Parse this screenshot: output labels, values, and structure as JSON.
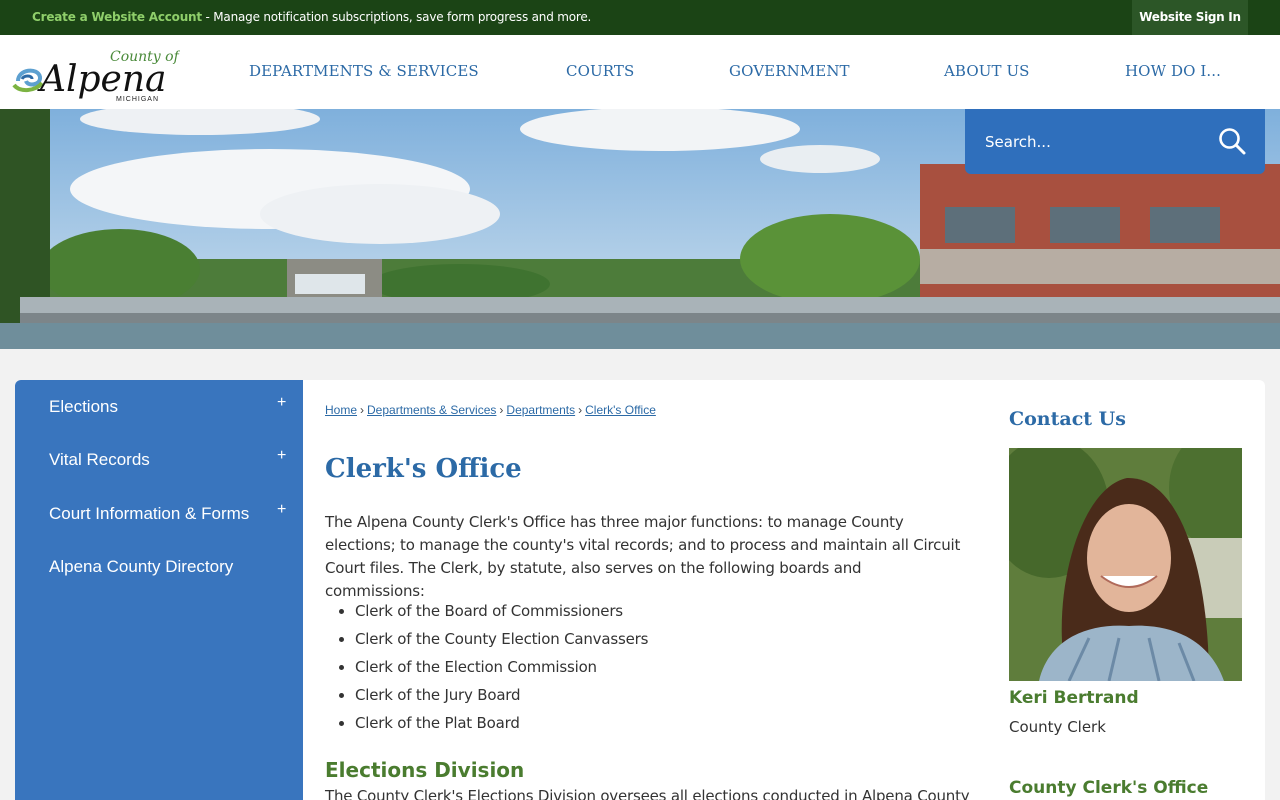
{
  "topbar": {
    "create_link": "Create a Website Account",
    "message": " - Manage notification subscriptions, save form progress and more.",
    "signin": "Website Sign In"
  },
  "logo": {
    "county_of": "County of",
    "name": "Alpena",
    "state": "MICHIGAN"
  },
  "nav": [
    "DEPARTMENTS & SERVICES",
    "COURTS",
    "GOVERNMENT",
    "ABOUT US",
    "HOW DO I..."
  ],
  "search": {
    "placeholder": "Search...",
    "icon": "search-icon"
  },
  "sidebar": {
    "items": [
      {
        "label": "Elections",
        "expand": "+"
      },
      {
        "label": "Vital Records",
        "expand": "+"
      },
      {
        "label": "Court Information & Forms",
        "expand": "+"
      },
      {
        "label": "Alpena County Directory"
      }
    ]
  },
  "breadcrumb": [
    "Home",
    "Departments & Services",
    "Departments",
    "Clerk's Office"
  ],
  "main": {
    "title": "Clerk's Office",
    "intro": "The Alpena County Clerk's Office has three major functions: to manage County elections; to manage the county's vital records; and to process and maintain all Circuit Court files. The Clerk, by statute, also serves on the following boards and commissions:",
    "roles": [
      "Clerk of the Board of Commissioners",
      "Clerk of the County Election Canvassers",
      "Clerk of the Election Commission",
      "Clerk of the Jury Board",
      "Clerk of the Plat Board"
    ],
    "section_title": "Elections Division",
    "section_text": "The County Clerk's Elections Division oversees all elections conducted in Alpena County"
  },
  "contact": {
    "title": "Contact Us",
    "name": "Keri Bertrand",
    "role": "County Clerk",
    "office": "County Clerk's Office"
  },
  "colors": {
    "topbar": "#1b4415",
    "accent_blue": "#2c6aa6",
    "sidebar": "#3975be",
    "green_heading": "#4a7c2f"
  }
}
